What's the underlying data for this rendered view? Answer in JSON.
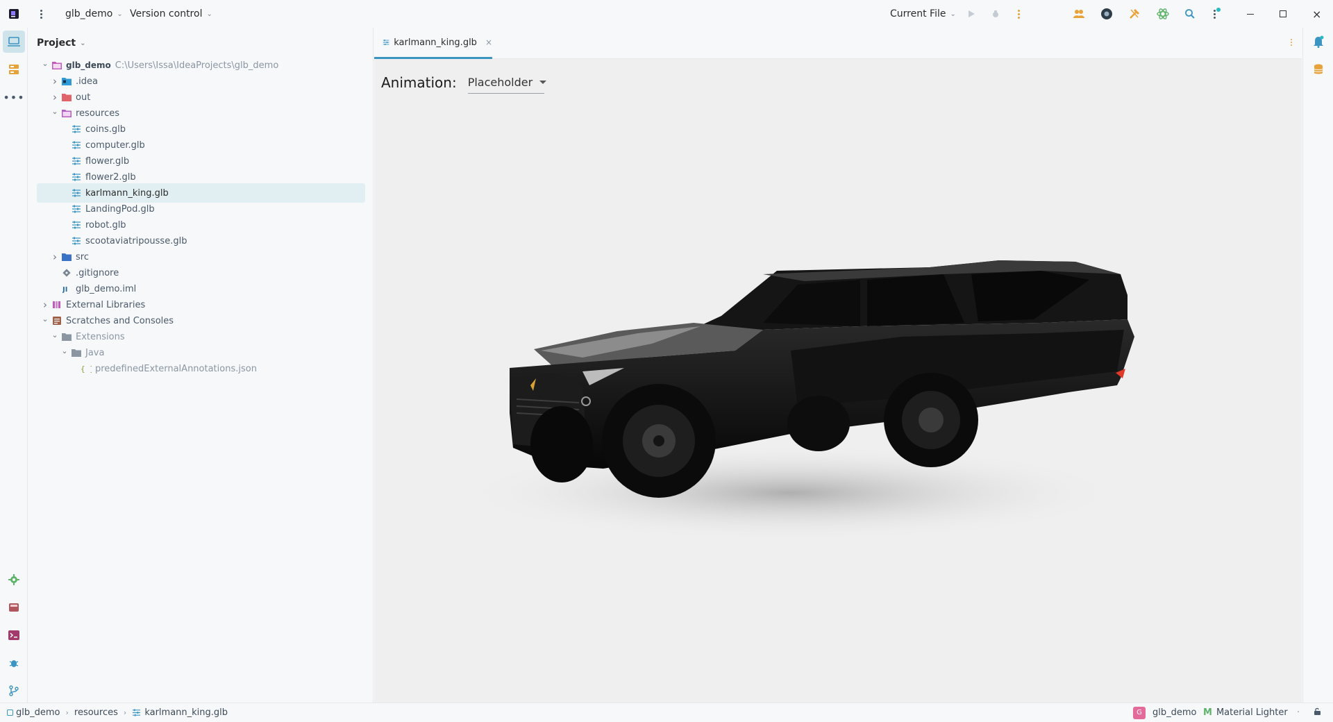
{
  "titlebar": {
    "project_name": "glb_demo",
    "vcs_label": "Version control",
    "run_config": "Current File"
  },
  "project_panel": {
    "title": "Project",
    "tree": [
      {
        "label": "glb_demo",
        "path": "C:\\Users\\Issa\\IdeaProjects\\glb_demo",
        "icon": "module-folder-icon",
        "level": 0,
        "expanded": true
      },
      {
        "label": ".idea",
        "icon": "idea-folder-icon",
        "level": 1,
        "expanded": false
      },
      {
        "label": "out",
        "icon": "out-folder-icon",
        "level": 1,
        "expanded": false
      },
      {
        "label": "resources",
        "icon": "resources-folder-icon",
        "level": 1,
        "expanded": true
      },
      {
        "label": "coins.glb",
        "icon": "glb-file-icon",
        "level": 2
      },
      {
        "label": "computer.glb",
        "icon": "glb-file-icon",
        "level": 2
      },
      {
        "label": "flower.glb",
        "icon": "glb-file-icon",
        "level": 2
      },
      {
        "label": "flower2.glb",
        "icon": "glb-file-icon",
        "level": 2
      },
      {
        "label": "karlmann_king.glb",
        "icon": "glb-file-icon",
        "level": 2,
        "selected": true
      },
      {
        "label": "LandingPod.glb",
        "icon": "glb-file-icon",
        "level": 2
      },
      {
        "label": "robot.glb",
        "icon": "glb-file-icon",
        "level": 2
      },
      {
        "label": "scootaviatripousse.glb",
        "icon": "glb-file-icon",
        "level": 2
      },
      {
        "label": "src",
        "icon": "src-folder-icon",
        "level": 1,
        "expanded": false
      },
      {
        "label": ".gitignore",
        "icon": "gitignore-file-icon",
        "level": 1
      },
      {
        "label": "glb_demo.iml",
        "icon": "iml-file-icon",
        "level": 1
      },
      {
        "label": "External Libraries",
        "icon": "libraries-icon",
        "level": 0,
        "expanded": false
      },
      {
        "label": "Scratches and Consoles",
        "icon": "scratches-icon",
        "level": 0,
        "expanded": true
      },
      {
        "label": "Extensions",
        "icon": "folder-icon",
        "level": 1,
        "expanded": true
      },
      {
        "label": "Java",
        "icon": "folder-icon",
        "level": 2,
        "expanded": true
      },
      {
        "label": "predefinedExternalAnnotations.json",
        "icon": "json-file-icon",
        "level": 3
      }
    ]
  },
  "editor": {
    "tab_label": "karlmann_king.glb",
    "animation_label": "Animation:",
    "animation_value": "Placeholder"
  },
  "statusbar": {
    "crumbs": [
      "glb_demo",
      "resources",
      "karlmann_king.glb"
    ],
    "project_badge": "G",
    "project": "glb_demo",
    "theme": "Material Lighter"
  },
  "colors": {
    "accent": "#3a95c2",
    "selection": "#e1eff3",
    "orange": "#e8a23a",
    "green": "#5fb36a",
    "pink": "#e46a9a"
  }
}
